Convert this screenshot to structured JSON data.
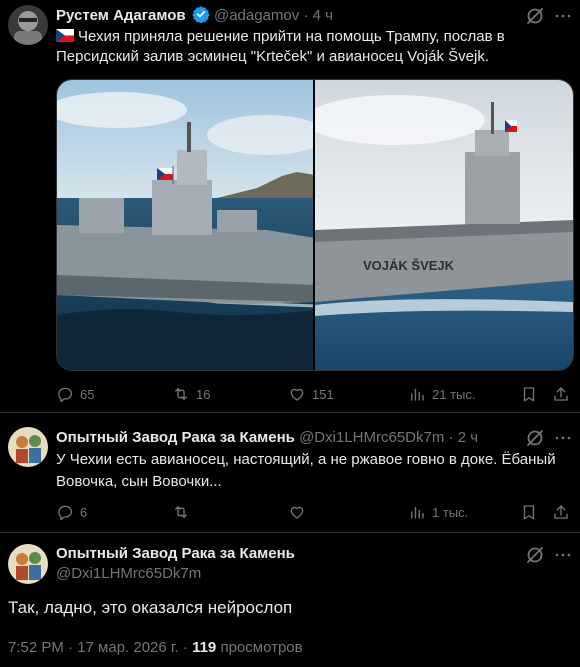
{
  "tweet1": {
    "name": "Рустем Адагамов",
    "handle": "@adagamov",
    "time": "4 ч",
    "text": "Чехия приняла решение прийти на помощь Трампу, послав в Персидский залив эсминец \"Krteček\" и авианосец Voják Švejk.",
    "ship_label": "VOJÁK ŠVEJK",
    "stats": {
      "replies": "65",
      "reposts": "16",
      "likes": "151",
      "views": "21 тыс."
    }
  },
  "tweet2": {
    "name": "Опытный Завод Рака за Камень",
    "handle": "@Dxi1LHMrc65Dk7m",
    "time": "2 ч",
    "text": "У Чехии есть авианосец, настоящий, а не ржавое говно в доке. Ёбаный Вовочка, сын Вовочки...",
    "stats": {
      "replies": "6",
      "views": "1 тыс."
    }
  },
  "tweet3": {
    "name": "Опытный Завод Рака за Камень",
    "handle": "@Dxi1LHMrc65Dk7m",
    "text": "Так, ладно, это оказался нейрослоп",
    "timestamp": "7:52 PM · 17 мар. 2026 г.",
    "views_count": "119",
    "views_label": "просмотров"
  },
  "colors": {
    "background": "#000000",
    "text": "#e7e9ea",
    "muted": "#71767b",
    "verified": "#1d9bf0",
    "divider": "#2f3336"
  },
  "icons": [
    "verified-badge-icon",
    "grok-icon",
    "more-icon",
    "reply-icon",
    "repost-icon",
    "like-icon",
    "views-icon",
    "bookmark-icon",
    "share-icon"
  ]
}
